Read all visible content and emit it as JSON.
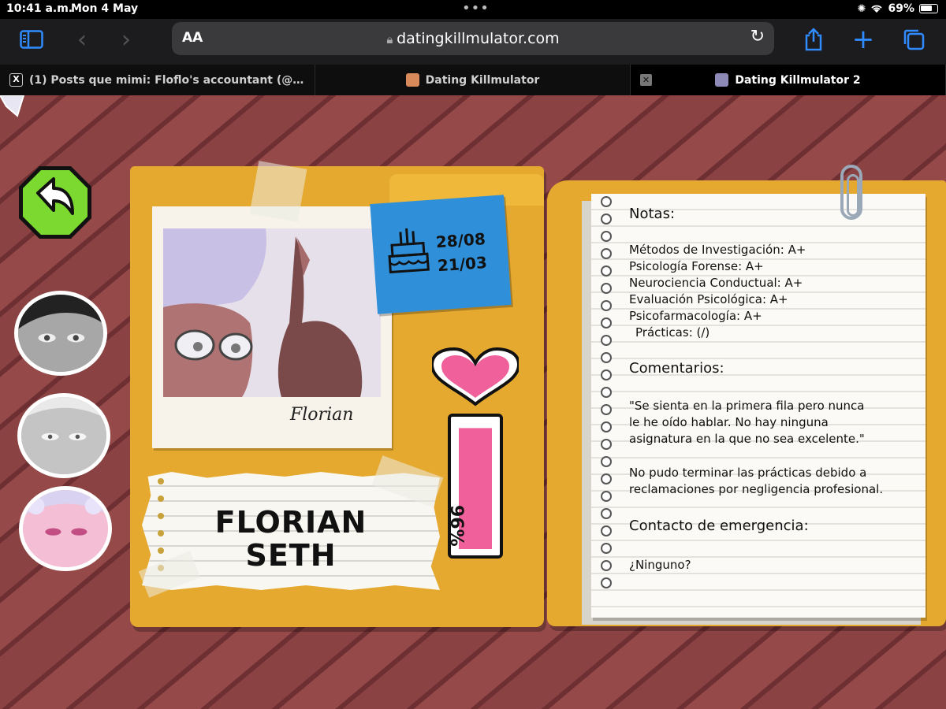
{
  "status_bar": {
    "time": "10:41 a.m.",
    "date": "Mon 4 May",
    "battery": "69%"
  },
  "browser": {
    "url": "datingkillmulator.com",
    "text_size_label": "AA",
    "tabs": [
      {
        "label": "(1) Posts que mimi: Floflo's accountant (@...",
        "active": false
      },
      {
        "label": "Dating Killmulator",
        "active": false
      },
      {
        "label": "Dating Killmulator 2",
        "active": true
      }
    ]
  },
  "profile": {
    "first_name": "FLORIAN",
    "last_name": "SETH",
    "signature": "Florian",
    "birthday_1": "28/08",
    "birthday_2": "21/03",
    "affinity": "96%",
    "affinity_value": 0.96
  },
  "notes": {
    "title": "Notas:",
    "grades": [
      "Métodos de Investigación: A+",
      "Psicología Forense: A+",
      "Neurociencia Conductual: A+",
      "Evaluación Psicológica: A+",
      "Psicofarmacología: A+",
      "Prácticas: (/)"
    ],
    "comments_title": "Comentarios:",
    "comment_1_line_1": "\"Se sienta en la primera fila pero nunca",
    "comment_1_line_2": "le he oído hablar. No hay ninguna",
    "comment_1_line_3": "asignatura en la que no sea excelente.\"",
    "comment_2_line_1": "No pudo terminar las prácticas debido a",
    "comment_2_line_2": "reclamaciones por negligencia profesional.",
    "emergency_title": "Contacto de emergencia:",
    "emergency_value": "¿Ninguno?"
  },
  "colors": {
    "folder": "#e6a92f",
    "sticky_note": "#2f8fd8",
    "back_button": "#7bd92f",
    "meter_pink": "#f0609b",
    "safari_blue": "#2f8bff"
  }
}
